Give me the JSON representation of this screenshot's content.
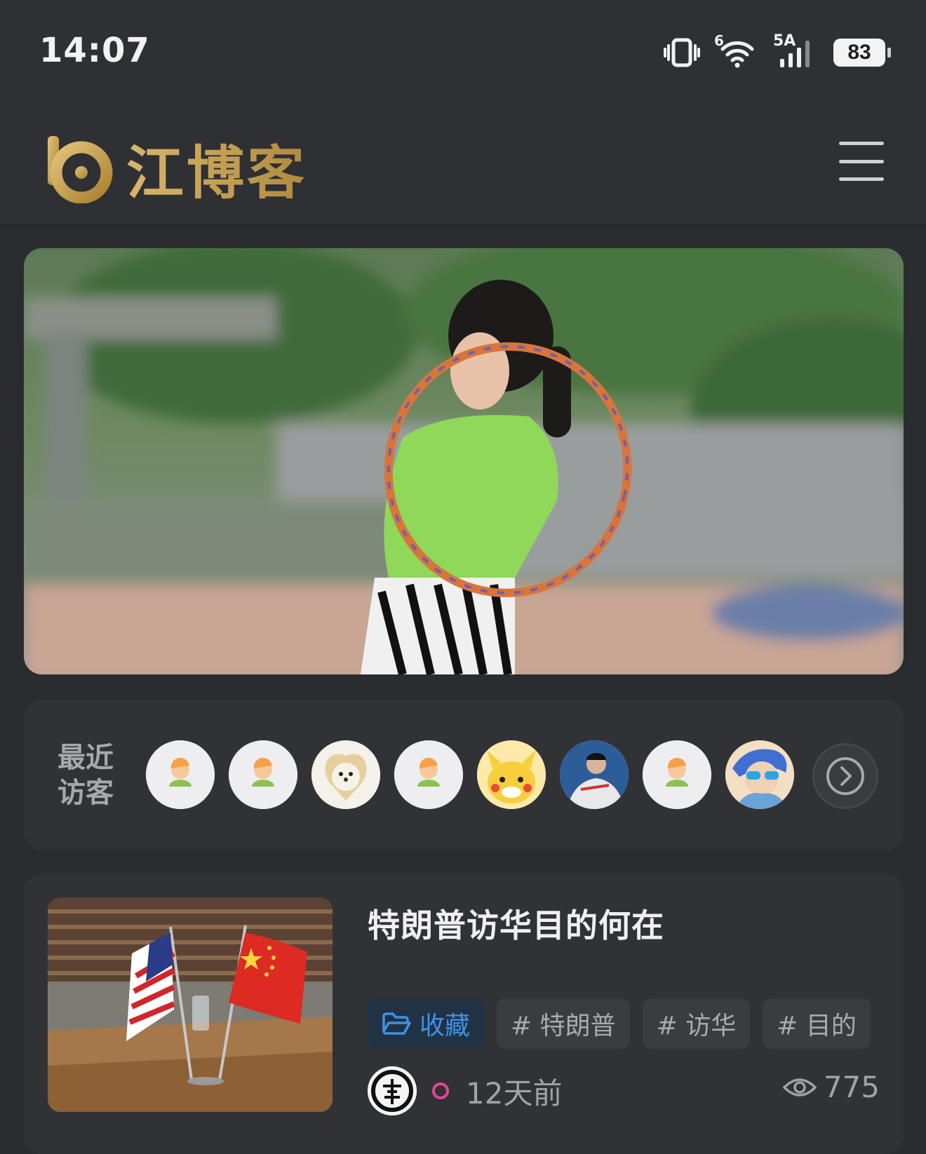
{
  "status_bar": {
    "time": "14:07",
    "battery": "83",
    "network_label": "5A",
    "wifi_label": "6"
  },
  "header": {
    "site_name": "江博客",
    "logo_icon": "b-logo-icon",
    "menu_icon": "hamburger-menu-icon",
    "brand_color": "#d7b36a"
  },
  "banner": {
    "icon": "photo-girl-hula-hoop"
  },
  "visitors": {
    "title": "最近访客",
    "items": [
      {
        "icon": "default-user-avatar"
      },
      {
        "icon": "default-user-avatar"
      },
      {
        "icon": "white-dog-avatar"
      },
      {
        "icon": "default-user-avatar"
      },
      {
        "icon": "pikachu-avatar"
      },
      {
        "icon": "person-photo-avatar"
      },
      {
        "icon": "default-user-avatar"
      },
      {
        "icon": "cartoon-sunglasses-avatar"
      }
    ],
    "more_icon": "chevron-right-circle-icon"
  },
  "article": {
    "title": "特朗普访华目的何在",
    "thumbnail_icon": "us-china-flags-photo",
    "category": {
      "icon": "folder-icon",
      "label": "收藏",
      "color": "#3d92e8"
    },
    "tags": [
      "# 特朗普",
      "# 访华",
      "# 目的"
    ],
    "time_ago": "12天前",
    "views": "775",
    "views_icon": "eye-icon"
  }
}
